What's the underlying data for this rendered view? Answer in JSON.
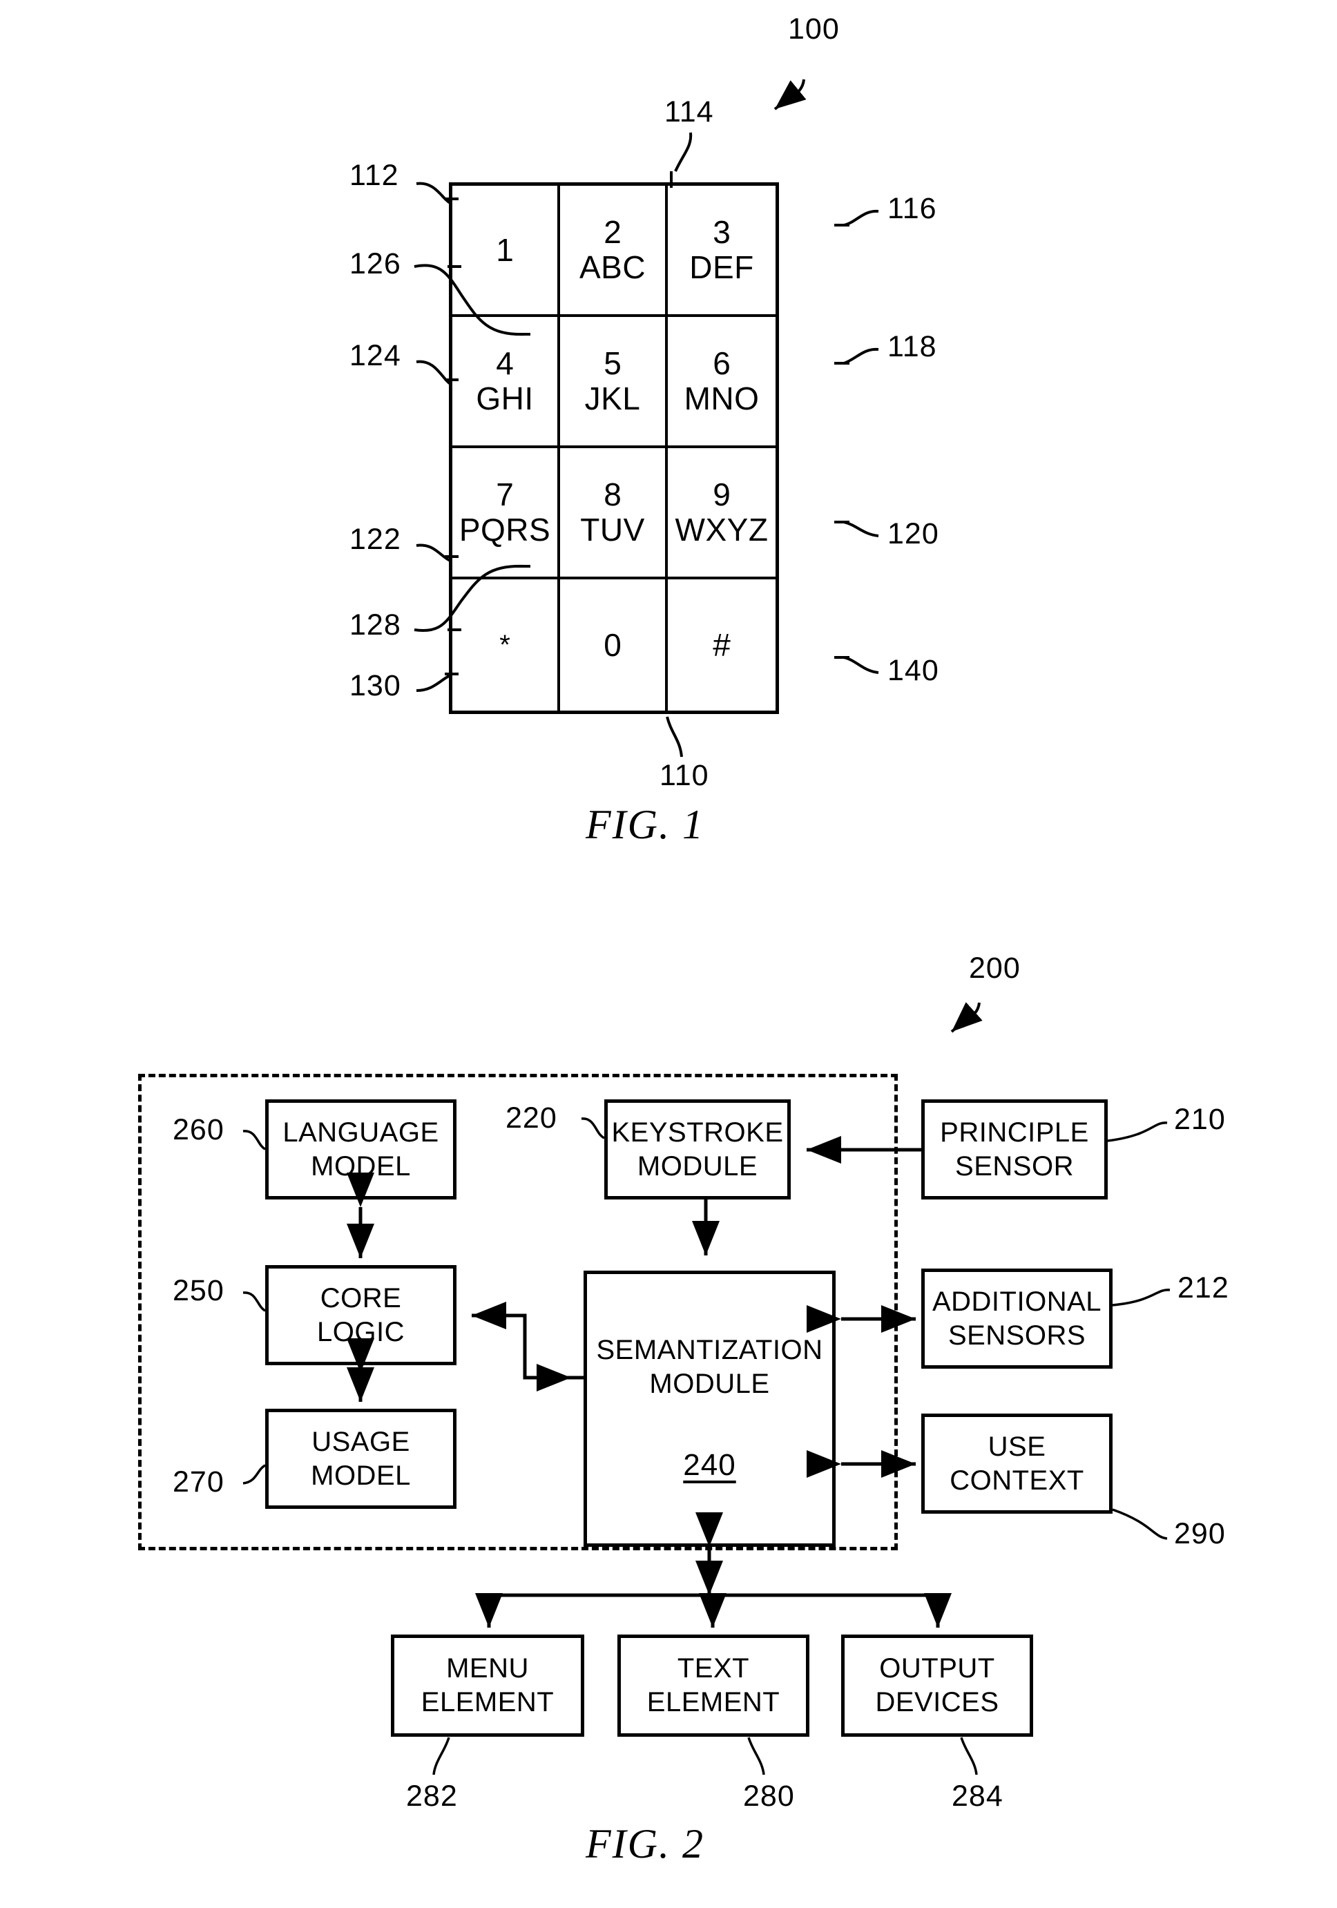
{
  "figures": [
    {
      "id": "fig1",
      "caption": "FIG. 1",
      "assembly_ref": "100",
      "keypad_ref": "110",
      "keys": [
        {
          "digit": "1",
          "letters": ""
        },
        {
          "digit": "2",
          "letters": "ABC"
        },
        {
          "digit": "3",
          "letters": "DEF"
        },
        {
          "digit": "4",
          "letters": "GHI"
        },
        {
          "digit": "5",
          "letters": "JKL"
        },
        {
          "digit": "6",
          "letters": "MNO"
        },
        {
          "digit": "7",
          "letters": "PQRS"
        },
        {
          "digit": "8",
          "letters": "TUV"
        },
        {
          "digit": "9",
          "letters": "WXYZ"
        },
        {
          "digit": "*",
          "letters": ""
        },
        {
          "digit": "0",
          "letters": ""
        },
        {
          "digit": "#",
          "letters": ""
        }
      ],
      "refs": {
        "left_key1": "112",
        "top_key2": "114",
        "right_key3": "116",
        "right_key6": "118",
        "right_key9": "120",
        "left_key7": "122",
        "left_key4": "124",
        "boundary_upper": "126",
        "boundary_lower": "128",
        "left_key_star": "130",
        "right_key_hash": "140"
      }
    },
    {
      "id": "fig2",
      "caption": "FIG. 2",
      "assembly_ref": "200",
      "blocks": [
        {
          "key": "language_model",
          "lines": [
            "LANGUAGE",
            "MODEL"
          ],
          "ref": "260"
        },
        {
          "key": "keystroke_module",
          "lines": [
            "KEYSTROKE",
            "MODULE"
          ],
          "ref": "220"
        },
        {
          "key": "principle_sensor",
          "lines": [
            "PRINCIPLE",
            "SENSOR"
          ],
          "ref": "210"
        },
        {
          "key": "core_logic",
          "lines": [
            "CORE",
            "LOGIC"
          ],
          "ref": "250"
        },
        {
          "key": "semantization_module",
          "lines": [
            "SEMANTIZATION",
            "MODULE"
          ],
          "tag": "240",
          "ref": "240"
        },
        {
          "key": "additional_sensors",
          "lines": [
            "ADDITIONAL",
            "SENSORS"
          ],
          "ref": "212"
        },
        {
          "key": "usage_model",
          "lines": [
            "USAGE",
            "MODEL"
          ],
          "ref": "270"
        },
        {
          "key": "use_context",
          "lines": [
            "USE",
            "CONTEXT"
          ],
          "ref": "290"
        },
        {
          "key": "menu_element",
          "lines": [
            "MENU",
            "ELEMENT"
          ],
          "ref": "282"
        },
        {
          "key": "text_element",
          "lines": [
            "TEXT",
            "ELEMENT"
          ],
          "ref": "280"
        },
        {
          "key": "output_devices",
          "lines": [
            "OUTPUT",
            "DEVICES"
          ],
          "ref": "284"
        }
      ]
    }
  ]
}
